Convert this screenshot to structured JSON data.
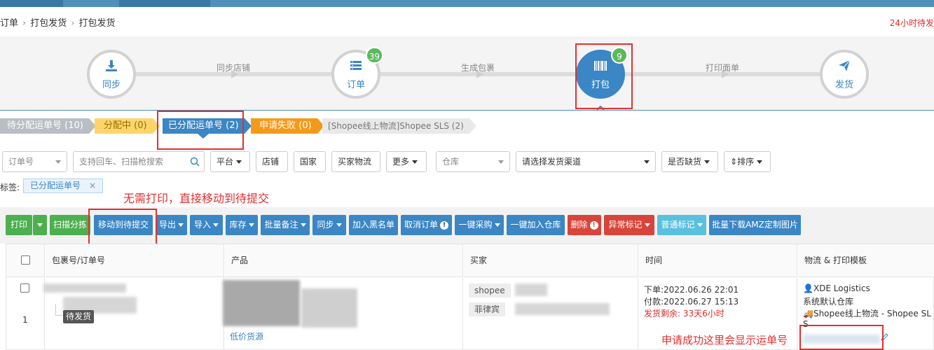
{
  "breadcrumb": {
    "items": [
      "订单",
      "打包发货",
      "打包发货"
    ]
  },
  "top_notice": "24小时待发",
  "stepper": {
    "steps": [
      {
        "label": "同步",
        "icon": "download-icon",
        "badge": ""
      },
      {
        "label": "订单",
        "icon": "list-icon",
        "badge": "39"
      },
      {
        "label": "打包",
        "icon": "barcode-icon",
        "badge": "9"
      },
      {
        "label": "发货",
        "icon": "send-icon",
        "badge": ""
      }
    ],
    "connectors": [
      "同步店铺",
      "生成包裹",
      "打印面单"
    ],
    "active_step": "打包"
  },
  "status_tabs": [
    {
      "label": "待分配运单号 (10)",
      "style": "gray"
    },
    {
      "label": "分配中 (0)",
      "style": "yellow"
    },
    {
      "label": "已分配运单号 (2)",
      "style": "blue"
    },
    {
      "label": "申请失败 (0)",
      "style": "orange"
    },
    {
      "label": "[Shopee线上物流]Shopee SLS (2)",
      "style": "lightgray"
    }
  ],
  "filters": {
    "order_no": "订单号",
    "search_placeholder": "支持回车、扫描枪搜索",
    "platform": "平台",
    "shop": "店铺",
    "country": "国家",
    "buyer_logistics": "买家物流",
    "more": "更多",
    "warehouse": "仓库",
    "shipping_channel": "请选择发货渠道",
    "out_of_stock": "是否缺货",
    "sort": "排序"
  },
  "tags": {
    "label": "标签:",
    "chip": "已分配运单号",
    "chip_close": "×"
  },
  "annotations": {
    "no_print": "无需打印，直接移动到待提交",
    "tracking_shown": "申请成功这里会显示运单号"
  },
  "toolbar": {
    "print": "打印",
    "scan_sort": "扫描分拣",
    "move_to_pending": "移动到待提交",
    "export": "导出",
    "import": "导入",
    "inventory": "库存",
    "batch_note": "批量备注",
    "sync": "同步",
    "add_blacklist": "加入黑名单",
    "cancel_order": "取消订单",
    "one_click_purchase": "一键采购",
    "one_click_warehouse": "一键加入仓库",
    "delete": "删除",
    "exception_mark": "异常标记",
    "normal_mark": "普通标记",
    "batch_download_amz": "批量下载AMZ定制图片"
  },
  "table": {
    "columns": [
      "包裹号/订单号",
      "产品",
      "买家",
      "时间",
      "物流 & 打印模板"
    ],
    "rows": [
      {
        "index": "1",
        "status": "待发货",
        "product_link": "低价货源",
        "buyer_platform": "shopee",
        "buyer_country": "菲律宾",
        "order_time": "下单:2022.06.26 22:01",
        "pay_time": "付款:2022.06.27 15:13",
        "ship_remaining": "发货剩余: 33天6小时",
        "logistics_provider": "XDE Logistics",
        "warehouse": "系统默认仓库",
        "channel": "Shopee线上物流 - Shopee SL",
        "channel_tail": "S"
      }
    ]
  },
  "colors": {
    "primary": "#3b86c4",
    "success": "#4caf50",
    "danger": "#d9443a",
    "annotation_red": "#e23030"
  }
}
